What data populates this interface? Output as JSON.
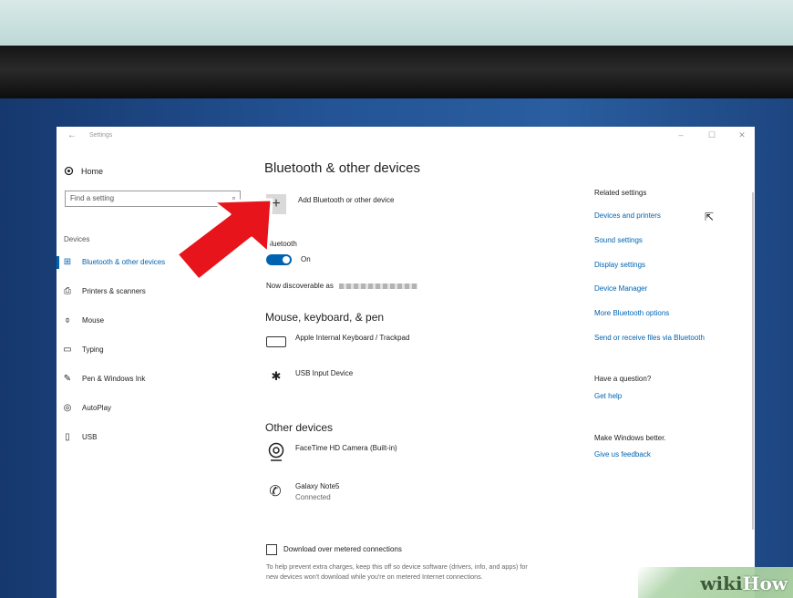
{
  "window": {
    "title": "Settings",
    "back_icon": "←",
    "minimize": "–",
    "maximize": "☐",
    "close": "✕"
  },
  "sidebar": {
    "home_label": "Home",
    "search": {
      "placeholder": "Find a setting"
    },
    "section": "Devices",
    "items": [
      {
        "label": "Bluetooth & other devices",
        "icon": "bluetooth-devices-icon",
        "glyph": "⊞",
        "active": true
      },
      {
        "label": "Printers & scanners",
        "icon": "printer-icon",
        "glyph": "⎙"
      },
      {
        "label": "Mouse",
        "icon": "mouse-icon",
        "glyph": "⌽"
      },
      {
        "label": "Typing",
        "icon": "keyboard-icon",
        "glyph": "▭"
      },
      {
        "label": "Pen & Windows Ink",
        "icon": "pen-icon",
        "glyph": "✎"
      },
      {
        "label": "AutoPlay",
        "icon": "autoplay-icon",
        "glyph": "◎"
      },
      {
        "label": "USB",
        "icon": "usb-icon",
        "glyph": "▯"
      }
    ]
  },
  "main": {
    "title": "Bluetooth & other devices",
    "add_button": {
      "symbol": "+",
      "label": "Add Bluetooth or other device"
    },
    "bluetooth": {
      "label": "Bluetooth",
      "toggle_state": "On",
      "discoverable_label": "Now discoverable as"
    },
    "mouse_section": {
      "title": "Mouse, keyboard, & pen",
      "devices": [
        {
          "name": "Apple Internal Keyboard / Trackpad",
          "icon": "keyboard-icon"
        },
        {
          "name": "USB Input Device",
          "icon": "bluetooth-icon"
        }
      ]
    },
    "other_section": {
      "title": "Other devices",
      "devices": [
        {
          "name": "FaceTime HD Camera (Built-in)",
          "icon": "webcam-icon"
        },
        {
          "name": "Galaxy Note5",
          "status": "Connected",
          "icon": "phone-icon"
        }
      ]
    },
    "metered": {
      "label": "Download over metered connections",
      "help": "To help prevent extra charges, keep this off so device software (drivers, info, and apps) for new devices won't download while you're on metered Internet connections."
    }
  },
  "related": {
    "title": "Related settings",
    "links": [
      "Devices and printers",
      "Sound settings",
      "Display settings",
      "Device Manager",
      "More Bluetooth options",
      "Send or receive files via Bluetooth"
    ],
    "question": {
      "title": "Have a question?",
      "link": "Get help"
    },
    "feedback": {
      "title": "Make Windows better.",
      "link": "Give us feedback"
    }
  },
  "watermark": {
    "wiki": "wiki",
    "how": "How"
  },
  "colors": {
    "accent": "#0063b1",
    "arrow": "#e8141b"
  }
}
